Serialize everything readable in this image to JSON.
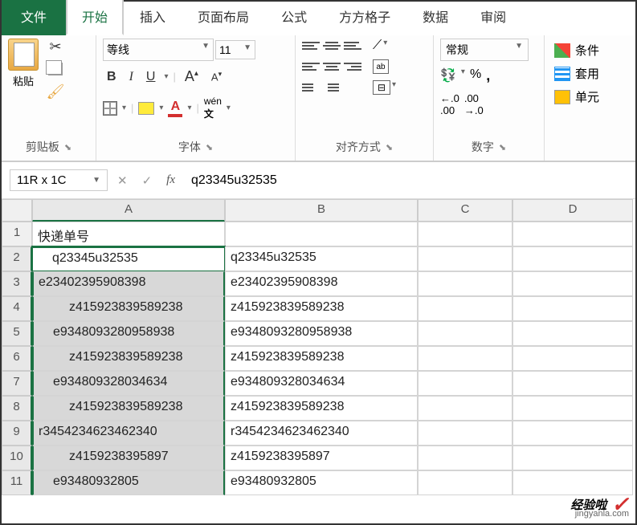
{
  "tabs": {
    "file": "文件",
    "home": "开始",
    "insert": "插入",
    "layout": "页面布局",
    "formulas": "公式",
    "ffgz": "方方格子",
    "data": "数据",
    "review": "审阅"
  },
  "ribbon": {
    "clipboard": {
      "label": "剪贴板",
      "paste": "粘贴"
    },
    "font": {
      "label": "字体",
      "name": "等线",
      "size": "11",
      "wen": "wén"
    },
    "align": {
      "label": "对齐方式"
    },
    "number": {
      "label": "数字",
      "format": "常规",
      "curr": "%"
    },
    "styles": {
      "cond": "条件",
      "table": "套用",
      "cell": "单元"
    }
  },
  "namebox": "11R x 1C",
  "formula_value": "q23345u32535",
  "columns": [
    "A",
    "B",
    "C",
    "D"
  ],
  "rows": [
    {
      "n": "1",
      "a": "快递单号",
      "b": "",
      "sel": false,
      "indent": 0
    },
    {
      "n": "2",
      "a": "q23345u32535",
      "b": "q23345u32535",
      "sel": true,
      "active": true,
      "indent": 1
    },
    {
      "n": "3",
      "a": "e23402395908398",
      "b": "e23402395908398",
      "sel": true,
      "indent": 0
    },
    {
      "n": "4",
      "a": "z415923839589238",
      "b": "z415923839589238",
      "sel": true,
      "indent": 2
    },
    {
      "n": "5",
      "a": "e9348093280958938",
      "b": "e9348093280958938",
      "sel": true,
      "indent": 1
    },
    {
      "n": "6",
      "a": "z415923839589238",
      "b": "z415923839589238",
      "sel": true,
      "indent": 2
    },
    {
      "n": "7",
      "a": "e934809328034634",
      "b": "e934809328034634",
      "sel": true,
      "indent": 1
    },
    {
      "n": "8",
      "a": "z415923839589238",
      "b": "z415923839589238",
      "sel": true,
      "indent": 2
    },
    {
      "n": "9",
      "a": "r3454234623462340",
      "b": "r3454234623462340",
      "sel": true,
      "indent": 0
    },
    {
      "n": "10",
      "a": "z4159238395897",
      "b": "z4159238395897",
      "sel": true,
      "indent": 2
    },
    {
      "n": "11",
      "a": "e93480932805",
      "b": "e93480932805",
      "sel": true,
      "indent": 1
    }
  ],
  "watermark": {
    "main": "经验啦",
    "sub": "jingyanla.com"
  }
}
